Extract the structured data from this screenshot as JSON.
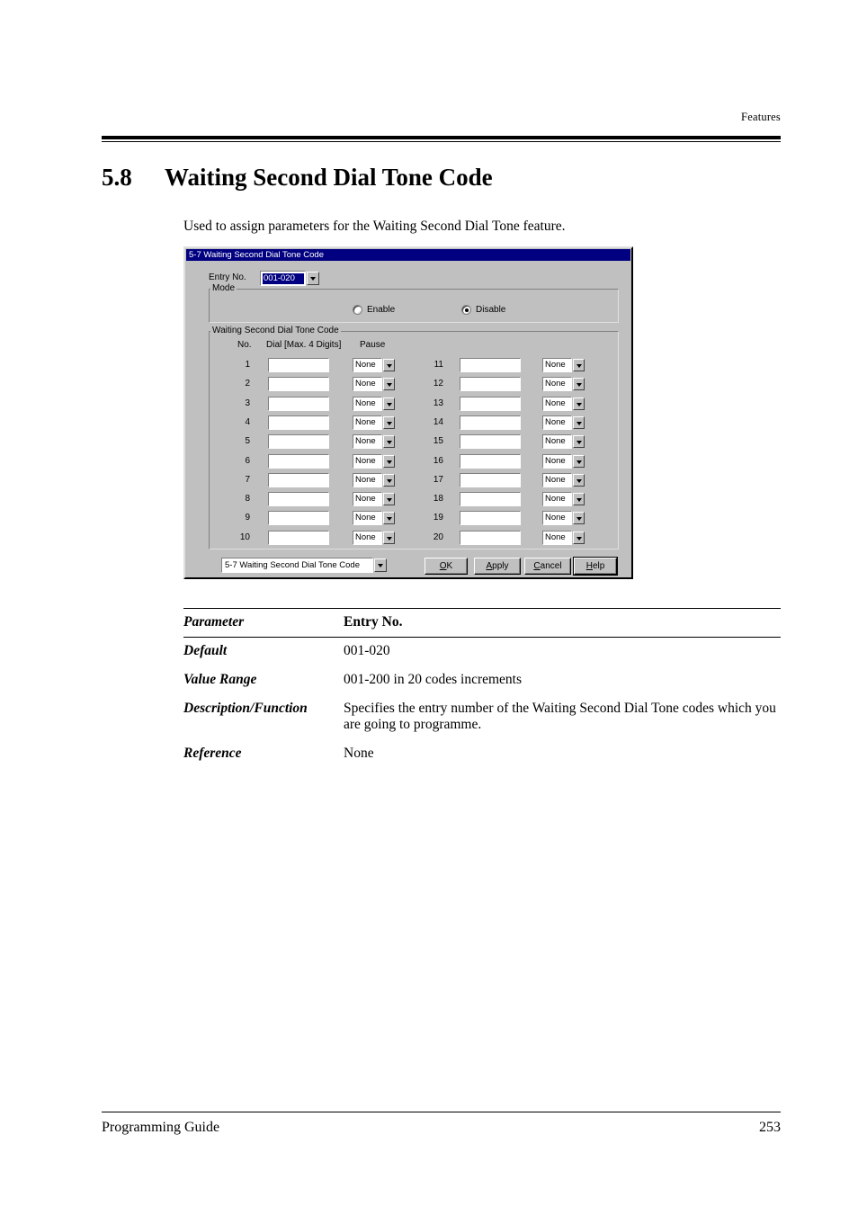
{
  "page": {
    "running_head": "Features",
    "section_number": "5.8",
    "section_title": "Waiting Second Dial Tone Code",
    "intro": "Used to assign parameters for the Waiting Second Dial Tone feature.",
    "footer_left": "Programming Guide",
    "footer_page": "253"
  },
  "dialog": {
    "title": "5-7 Waiting Second Dial Tone Code",
    "entry_no_label": "Entry No.",
    "entry_no_value": "001-020",
    "mode_group_label": "Mode",
    "mode_options": [
      {
        "label": "Enable",
        "selected": false
      },
      {
        "label": "Disable",
        "selected": true
      }
    ],
    "code_group_label": "Waiting Second Dial Tone Code",
    "columns": {
      "no": "No.",
      "dial": "Dial [Max. 4 Digits]",
      "pause": "Pause"
    },
    "rows_left": [
      {
        "no": "1",
        "dial": "",
        "pause": "None"
      },
      {
        "no": "2",
        "dial": "",
        "pause": "None"
      },
      {
        "no": "3",
        "dial": "",
        "pause": "None"
      },
      {
        "no": "4",
        "dial": "",
        "pause": "None"
      },
      {
        "no": "5",
        "dial": "",
        "pause": "None"
      },
      {
        "no": "6",
        "dial": "",
        "pause": "None"
      },
      {
        "no": "7",
        "dial": "",
        "pause": "None"
      },
      {
        "no": "8",
        "dial": "",
        "pause": "None"
      },
      {
        "no": "9",
        "dial": "",
        "pause": "None"
      },
      {
        "no": "10",
        "dial": "",
        "pause": "None"
      }
    ],
    "rows_right": [
      {
        "no": "11",
        "dial": "",
        "pause": "None"
      },
      {
        "no": "12",
        "dial": "",
        "pause": "None"
      },
      {
        "no": "13",
        "dial": "",
        "pause": "None"
      },
      {
        "no": "14",
        "dial": "",
        "pause": "None"
      },
      {
        "no": "15",
        "dial": "",
        "pause": "None"
      },
      {
        "no": "16",
        "dial": "",
        "pause": "None"
      },
      {
        "no": "17",
        "dial": "",
        "pause": "None"
      },
      {
        "no": "18",
        "dial": "",
        "pause": "None"
      },
      {
        "no": "19",
        "dial": "",
        "pause": "None"
      },
      {
        "no": "20",
        "dial": "",
        "pause": "None"
      }
    ],
    "nav_combo_value": "5-7 Waiting Second Dial Tone Code",
    "buttons": [
      {
        "label": "OK",
        "mnemonic": "O",
        "default": false
      },
      {
        "label": "Apply",
        "mnemonic": "A",
        "default": false
      },
      {
        "label": "Cancel",
        "mnemonic": "C",
        "default": false
      },
      {
        "label": "Help",
        "mnemonic": "H",
        "default": true
      }
    ]
  },
  "parameter_table": {
    "header": {
      "key": "Parameter",
      "value": "Entry No."
    },
    "rows": [
      {
        "key": "Default",
        "value": "001-020"
      },
      {
        "key": "Value Range",
        "value": "001-200 in 20 codes increments"
      },
      {
        "key": "Description/Function",
        "value": "Specifies the entry number of the Waiting Second Dial Tone codes which you are going to programme."
      },
      {
        "key": "Reference",
        "value": "None"
      }
    ]
  },
  "colors": {
    "titlebar": "#000080",
    "dialog_face": "#c0c0c0",
    "selection": "#000080"
  }
}
